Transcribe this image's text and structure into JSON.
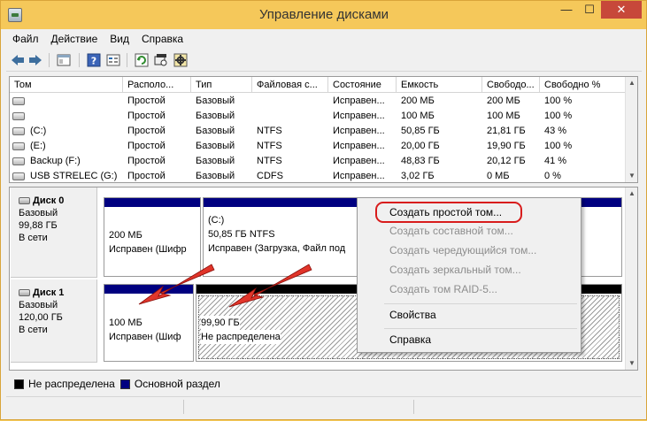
{
  "window": {
    "title": "Управление дисками",
    "minimize": "—",
    "maximize": "☐",
    "close": "✕"
  },
  "menu": [
    "Файл",
    "Действие",
    "Вид",
    "Справка"
  ],
  "volume_table": {
    "columns": [
      "Том",
      "Располо...",
      "Тип",
      "Файловая с...",
      "Состояние",
      "Емкость",
      "Свободо...",
      "Свободно %"
    ],
    "rows": [
      {
        "name": "",
        "layout": "Простой",
        "type": "Базовый",
        "fs": "",
        "status": "Исправен...",
        "capacity": "200 МБ",
        "free": "200 МБ",
        "free_pct": "100 %"
      },
      {
        "name": "",
        "layout": "Простой",
        "type": "Базовый",
        "fs": "",
        "status": "Исправен...",
        "capacity": "100 МБ",
        "free": "100 МБ",
        "free_pct": "100 %"
      },
      {
        "name": "(C:)",
        "layout": "Простой",
        "type": "Базовый",
        "fs": "NTFS",
        "status": "Исправен...",
        "capacity": "50,85 ГБ",
        "free": "21,81 ГБ",
        "free_pct": "43 %"
      },
      {
        "name": "(E:)",
        "layout": "Простой",
        "type": "Базовый",
        "fs": "NTFS",
        "status": "Исправен...",
        "capacity": "20,00 ГБ",
        "free": "19,90 ГБ",
        "free_pct": "100 %"
      },
      {
        "name": "Backup (F:)",
        "layout": "Простой",
        "type": "Базовый",
        "fs": "NTFS",
        "status": "Исправен...",
        "capacity": "48,83 ГБ",
        "free": "20,12 ГБ",
        "free_pct": "41 %"
      },
      {
        "name": "USB STRELEC (G:)",
        "layout": "Простой",
        "type": "Базовый",
        "fs": "CDFS",
        "status": "Исправен...",
        "capacity": "3,02 ГБ",
        "free": "0 МБ",
        "free_pct": "0 %"
      }
    ]
  },
  "disks": [
    {
      "name": "Диск 0",
      "kind": "Базовый",
      "size": "99,88 ГБ",
      "state": "В сети",
      "partitions": [
        {
          "title": "",
          "size": "200 МБ",
          "status": "Исправен (Шифр"
        },
        {
          "title": "(C:)",
          "size": "50,85 ГБ NTFS",
          "status": "Исправен (Загрузка, Файл под"
        }
      ]
    },
    {
      "name": "Диск 1",
      "kind": "Базовый",
      "size": "120,00 ГБ",
      "state": "В сети",
      "partitions": [
        {
          "title": "",
          "size": "100 МБ",
          "status": "Исправен (Шиф"
        },
        {
          "title": "",
          "size": "99,90 ГБ",
          "status": "Не распределена"
        }
      ]
    }
  ],
  "context_menu": {
    "items": [
      {
        "label": "Создать простой том...",
        "enabled": true,
        "highlighted": true
      },
      {
        "label": "Создать составной том...",
        "enabled": false
      },
      {
        "label": "Создать чередующийся том...",
        "enabled": false
      },
      {
        "label": "Создать зеркальный том...",
        "enabled": false
      },
      {
        "label": "Создать том RAID-5...",
        "enabled": false
      },
      {
        "label": "Свойства",
        "enabled": true
      },
      {
        "label": "Справка",
        "enabled": true
      }
    ]
  },
  "legend": [
    "Не распределена",
    "Основной раздел"
  ],
  "colors": {
    "titlebar": "#f5c85a",
    "primary_partition": "#000080",
    "unallocated": "#000000",
    "highlight_ring": "#d81c1c",
    "arrow": "#e0261d"
  },
  "icons": [
    "back-arrow-icon",
    "forward-arrow-icon",
    "console-tree-icon",
    "help-icon",
    "properties-icon",
    "refresh-icon",
    "rescan-icon",
    "settings-icon"
  ]
}
